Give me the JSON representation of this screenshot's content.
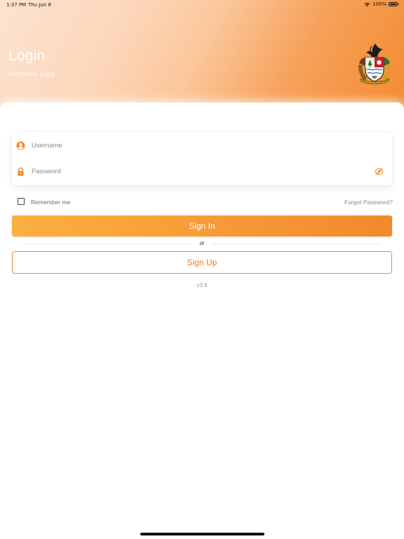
{
  "status_bar": {
    "time": "1:37 PM",
    "date": "Thu Jun 8",
    "battery": "100%"
  },
  "header": {
    "title": "Login",
    "subtitle": "Welcome Back"
  },
  "form": {
    "username_placeholder": "Username",
    "password_placeholder": "Password",
    "remember_label": "Remember me",
    "remember_checked": false,
    "forgot_label": "Forgot Password?"
  },
  "actions": {
    "signin_label": "Sign In",
    "or_label": "or",
    "signup_label": "Sign Up"
  },
  "version": "v3.8",
  "icons": {
    "username": "person-circle-icon",
    "password": "lock-icon",
    "visibility": "eye-slash-icon",
    "wifi": "wifi-icon",
    "battery": "battery-icon"
  },
  "colors": {
    "accent": "#f28a2e",
    "signin_gradient_start": "#fbb040",
    "signin_gradient_end": "#f2892b",
    "signup_text": "#ef7e1e"
  }
}
